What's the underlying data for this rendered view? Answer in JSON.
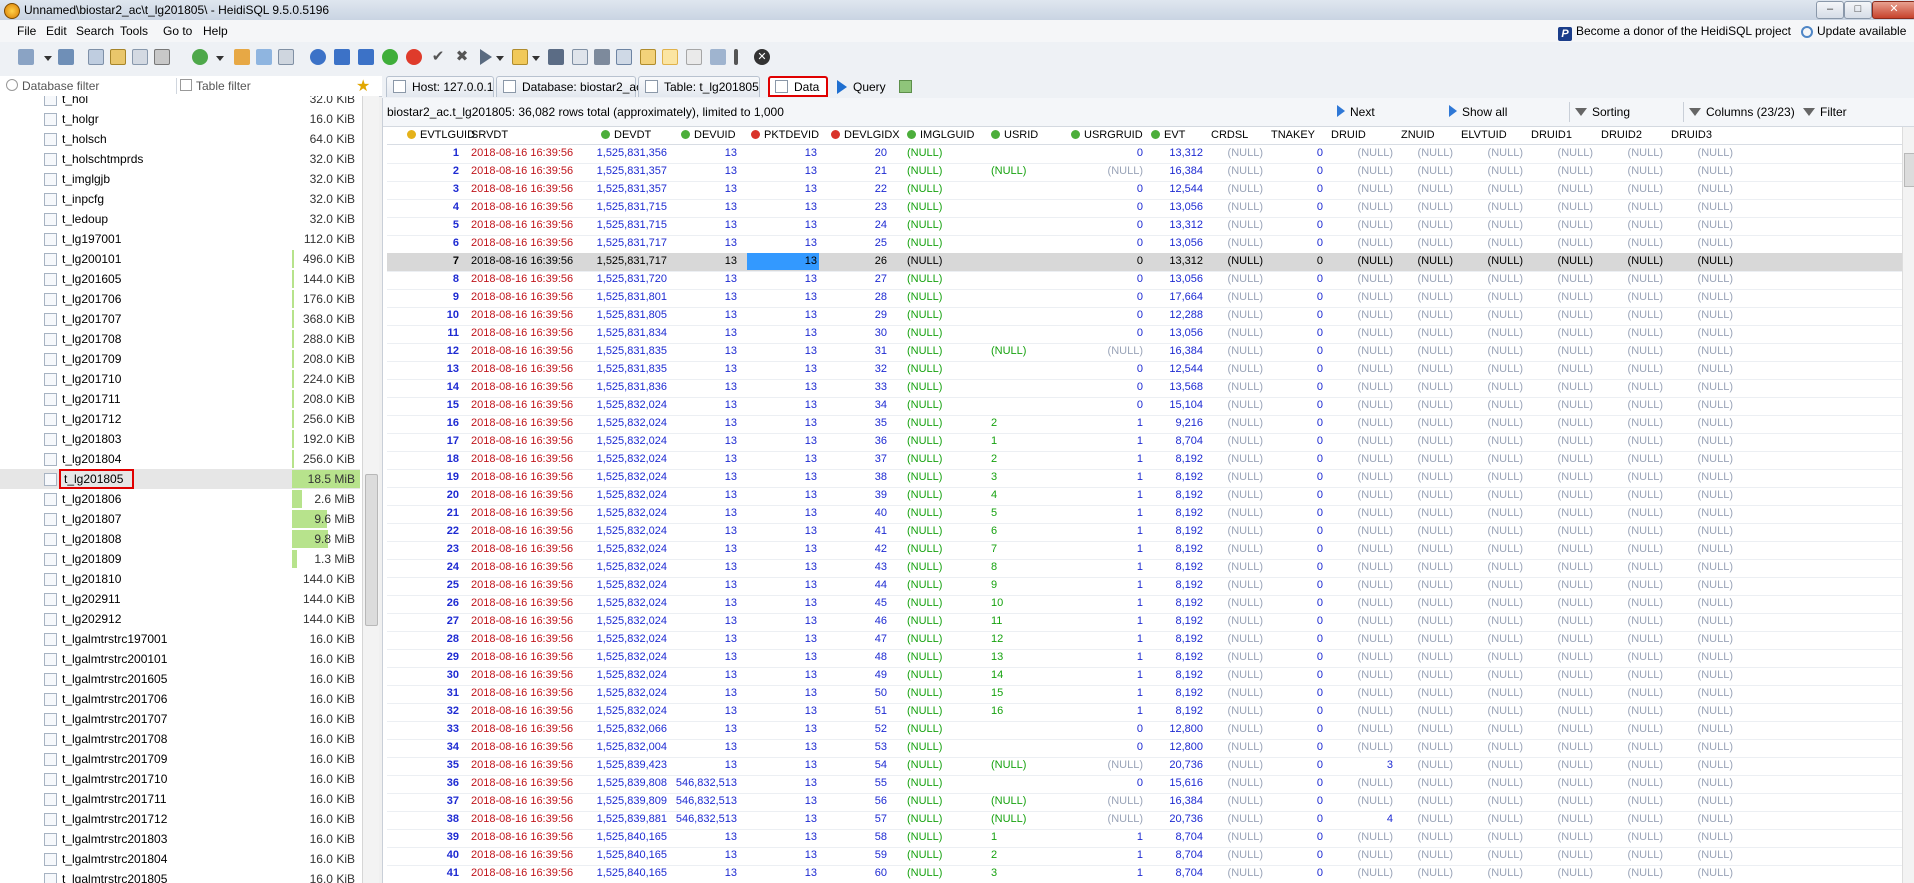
{
  "window": {
    "title": "Unnamed\\biostar2_ac\\t_lg201805\\ - HeidiSQL 9.5.0.5196",
    "controls": [
      "–",
      "□",
      "✕"
    ]
  },
  "menu": {
    "items": [
      "File",
      "Edit",
      "Search",
      "Tools",
      "Go to",
      "Help"
    ],
    "donor": "Become a donor of the HeidiSQL project",
    "update": "Update available"
  },
  "filters": {
    "database_placeholder": "Database filter",
    "table_placeholder": "Table filter"
  },
  "tree": {
    "items": [
      {
        "name": "t_hol",
        "size": "32.0 KiB",
        "bar": 0
      },
      {
        "name": "t_holgr",
        "size": "16.0 KiB",
        "bar": 0
      },
      {
        "name": "t_holsch",
        "size": "64.0 KiB",
        "bar": 0
      },
      {
        "name": "t_holschtmprds",
        "size": "32.0 KiB",
        "bar": 0
      },
      {
        "name": "t_imglgjb",
        "size": "32.0 KiB",
        "bar": 0
      },
      {
        "name": "t_inpcfg",
        "size": "32.0 KiB",
        "bar": 0
      },
      {
        "name": "t_ledoup",
        "size": "32.0 KiB",
        "bar": 0
      },
      {
        "name": "t_lg197001",
        "size": "112.0 KiB",
        "bar": 0
      },
      {
        "name": "t_lg200101",
        "size": "496.0 KiB",
        "bar": 0.03
      },
      {
        "name": "t_lg201605",
        "size": "144.0 KiB",
        "bar": 0.01
      },
      {
        "name": "t_lg201706",
        "size": "176.0 KiB",
        "bar": 0.01
      },
      {
        "name": "t_lg201707",
        "size": "368.0 KiB",
        "bar": 0.02
      },
      {
        "name": "t_lg201708",
        "size": "288.0 KiB",
        "bar": 0.02
      },
      {
        "name": "t_lg201709",
        "size": "208.0 KiB",
        "bar": 0.01
      },
      {
        "name": "t_lg201710",
        "size": "224.0 KiB",
        "bar": 0.01
      },
      {
        "name": "t_lg201711",
        "size": "208.0 KiB",
        "bar": 0.01
      },
      {
        "name": "t_lg201712",
        "size": "256.0 KiB",
        "bar": 0.01
      },
      {
        "name": "t_lg201803",
        "size": "192.0 KiB",
        "bar": 0.01
      },
      {
        "name": "t_lg201804",
        "size": "256.0 KiB",
        "bar": 0.01
      },
      {
        "name": "t_lg201805",
        "size": "18.5 MiB",
        "bar": 1.0,
        "selected": true
      },
      {
        "name": "t_lg201806",
        "size": "2.6 MiB",
        "bar": 0.14
      },
      {
        "name": "t_lg201807",
        "size": "9.6 MiB",
        "bar": 0.52
      },
      {
        "name": "t_lg201808",
        "size": "9.8 MiB",
        "bar": 0.53
      },
      {
        "name": "t_lg201809",
        "size": "1.3 MiB",
        "bar": 0.07
      },
      {
        "name": "t_lg201810",
        "size": "144.0 KiB",
        "bar": 0
      },
      {
        "name": "t_lg202911",
        "size": "144.0 KiB",
        "bar": 0
      },
      {
        "name": "t_lg202912",
        "size": "144.0 KiB",
        "bar": 0
      },
      {
        "name": "t_lgalmtrstrc197001",
        "size": "16.0 KiB",
        "bar": 0
      },
      {
        "name": "t_lgalmtrstrc200101",
        "size": "16.0 KiB",
        "bar": 0
      },
      {
        "name": "t_lgalmtrstrc201605",
        "size": "16.0 KiB",
        "bar": 0
      },
      {
        "name": "t_lgalmtrstrc201706",
        "size": "16.0 KiB",
        "bar": 0
      },
      {
        "name": "t_lgalmtrstrc201707",
        "size": "16.0 KiB",
        "bar": 0
      },
      {
        "name": "t_lgalmtrstrc201708",
        "size": "16.0 KiB",
        "bar": 0
      },
      {
        "name": "t_lgalmtrstrc201709",
        "size": "16.0 KiB",
        "bar": 0
      },
      {
        "name": "t_lgalmtrstrc201710",
        "size": "16.0 KiB",
        "bar": 0
      },
      {
        "name": "t_lgalmtrstrc201711",
        "size": "16.0 KiB",
        "bar": 0
      },
      {
        "name": "t_lgalmtrstrc201712",
        "size": "16.0 KiB",
        "bar": 0
      },
      {
        "name": "t_lgalmtrstrc201803",
        "size": "16.0 KiB",
        "bar": 0
      },
      {
        "name": "t_lgalmtrstrc201804",
        "size": "16.0 KiB",
        "bar": 0
      },
      {
        "name": "t_lgalmtrstrc201805",
        "size": "16.0 KiB",
        "bar": 0
      }
    ]
  },
  "tabs": [
    {
      "label": "Host: 127.0.0.1"
    },
    {
      "label": "Database: biostar2_ac"
    },
    {
      "label": "Table: t_lg201805"
    },
    {
      "label": "Data",
      "active": true
    },
    {
      "label": "Query"
    }
  ],
  "info": {
    "text": "biostar2_ac.t_lg201805: 36,082 rows total (approximately), limited to 1,000",
    "next": "Next",
    "show_all": "Show all",
    "sorting": "Sorting",
    "columns": "Columns (23/23)",
    "filter": "Filter"
  },
  "columns": [
    "EVTLGUID",
    "SRVDT",
    "DEVDT",
    "DEVUID",
    "PKTDEVID",
    "DEVLGIDX",
    "IMGLGUID",
    "USRID",
    "USRGRUID",
    "EVT",
    "CRDSL",
    "TNAKEY",
    "DRUID",
    "ZNUID",
    "ELVTUID",
    "DRUID1",
    "DRUID2",
    "DRUID3"
  ],
  "rows": [
    [
      "1",
      "2018-08-16 16:39:56",
      "1,525,831,356",
      "13",
      "13",
      "20",
      "(NULL)",
      "",
      "0",
      "13,312",
      "(NULL)",
      "0",
      "(NULL)",
      "(NULL)",
      "(NULL)",
      "(NULL)",
      "(NULL)",
      "(NULL)"
    ],
    [
      "2",
      "2018-08-16 16:39:56",
      "1,525,831,357",
      "13",
      "13",
      "21",
      "(NULL)",
      "(NULL)",
      "(NULL)",
      "16,384",
      "(NULL)",
      "0",
      "(NULL)",
      "(NULL)",
      "(NULL)",
      "(NULL)",
      "(NULL)",
      "(NULL)"
    ],
    [
      "3",
      "2018-08-16 16:39:56",
      "1,525,831,357",
      "13",
      "13",
      "22",
      "(NULL)",
      "",
      "0",
      "12,544",
      "(NULL)",
      "0",
      "(NULL)",
      "(NULL)",
      "(NULL)",
      "(NULL)",
      "(NULL)",
      "(NULL)"
    ],
    [
      "4",
      "2018-08-16 16:39:56",
      "1,525,831,715",
      "13",
      "13",
      "23",
      "(NULL)",
      "",
      "0",
      "13,056",
      "(NULL)",
      "0",
      "(NULL)",
      "(NULL)",
      "(NULL)",
      "(NULL)",
      "(NULL)",
      "(NULL)"
    ],
    [
      "5",
      "2018-08-16 16:39:56",
      "1,525,831,715",
      "13",
      "13",
      "24",
      "(NULL)",
      "",
      "0",
      "13,312",
      "(NULL)",
      "0",
      "(NULL)",
      "(NULL)",
      "(NULL)",
      "(NULL)",
      "(NULL)",
      "(NULL)"
    ],
    [
      "6",
      "2018-08-16 16:39:56",
      "1,525,831,717",
      "13",
      "13",
      "25",
      "(NULL)",
      "",
      "0",
      "13,056",
      "(NULL)",
      "0",
      "(NULL)",
      "(NULL)",
      "(NULL)",
      "(NULL)",
      "(NULL)",
      "(NULL)"
    ],
    [
      "7",
      "2018-08-16 16:39:56",
      "1,525,831,717",
      "13",
      "13",
      "26",
      "(NULL)",
      "",
      "0",
      "13,312",
      "(NULL)",
      "0",
      "(NULL)",
      "(NULL)",
      "(NULL)",
      "(NULL)",
      "(NULL)",
      "(NULL)"
    ],
    [
      "8",
      "2018-08-16 16:39:56",
      "1,525,831,720",
      "13",
      "13",
      "27",
      "(NULL)",
      "",
      "0",
      "13,056",
      "(NULL)",
      "0",
      "(NULL)",
      "(NULL)",
      "(NULL)",
      "(NULL)",
      "(NULL)",
      "(NULL)"
    ],
    [
      "9",
      "2018-08-16 16:39:56",
      "1,525,831,801",
      "13",
      "13",
      "28",
      "(NULL)",
      "",
      "0",
      "17,664",
      "(NULL)",
      "0",
      "(NULL)",
      "(NULL)",
      "(NULL)",
      "(NULL)",
      "(NULL)",
      "(NULL)"
    ],
    [
      "10",
      "2018-08-16 16:39:56",
      "1,525,831,805",
      "13",
      "13",
      "29",
      "(NULL)",
      "",
      "0",
      "12,288",
      "(NULL)",
      "0",
      "(NULL)",
      "(NULL)",
      "(NULL)",
      "(NULL)",
      "(NULL)",
      "(NULL)"
    ],
    [
      "11",
      "2018-08-16 16:39:56",
      "1,525,831,834",
      "13",
      "13",
      "30",
      "(NULL)",
      "",
      "0",
      "13,056",
      "(NULL)",
      "0",
      "(NULL)",
      "(NULL)",
      "(NULL)",
      "(NULL)",
      "(NULL)",
      "(NULL)"
    ],
    [
      "12",
      "2018-08-16 16:39:56",
      "1,525,831,835",
      "13",
      "13",
      "31",
      "(NULL)",
      "(NULL)",
      "(NULL)",
      "16,384",
      "(NULL)",
      "0",
      "(NULL)",
      "(NULL)",
      "(NULL)",
      "(NULL)",
      "(NULL)",
      "(NULL)"
    ],
    [
      "13",
      "2018-08-16 16:39:56",
      "1,525,831,835",
      "13",
      "13",
      "32",
      "(NULL)",
      "",
      "0",
      "12,544",
      "(NULL)",
      "0",
      "(NULL)",
      "(NULL)",
      "(NULL)",
      "(NULL)",
      "(NULL)",
      "(NULL)"
    ],
    [
      "14",
      "2018-08-16 16:39:56",
      "1,525,831,836",
      "13",
      "13",
      "33",
      "(NULL)",
      "",
      "0",
      "13,568",
      "(NULL)",
      "0",
      "(NULL)",
      "(NULL)",
      "(NULL)",
      "(NULL)",
      "(NULL)",
      "(NULL)"
    ],
    [
      "15",
      "2018-08-16 16:39:56",
      "1,525,832,024",
      "13",
      "13",
      "34",
      "(NULL)",
      "",
      "0",
      "15,104",
      "(NULL)",
      "0",
      "(NULL)",
      "(NULL)",
      "(NULL)",
      "(NULL)",
      "(NULL)",
      "(NULL)"
    ],
    [
      "16",
      "2018-08-16 16:39:56",
      "1,525,832,024",
      "13",
      "13",
      "35",
      "(NULL)",
      "2",
      "1",
      "9,216",
      "(NULL)",
      "0",
      "(NULL)",
      "(NULL)",
      "(NULL)",
      "(NULL)",
      "(NULL)",
      "(NULL)"
    ],
    [
      "17",
      "2018-08-16 16:39:56",
      "1,525,832,024",
      "13",
      "13",
      "36",
      "(NULL)",
      "1",
      "1",
      "8,704",
      "(NULL)",
      "0",
      "(NULL)",
      "(NULL)",
      "(NULL)",
      "(NULL)",
      "(NULL)",
      "(NULL)"
    ],
    [
      "18",
      "2018-08-16 16:39:56",
      "1,525,832,024",
      "13",
      "13",
      "37",
      "(NULL)",
      "2",
      "1",
      "8,192",
      "(NULL)",
      "0",
      "(NULL)",
      "(NULL)",
      "(NULL)",
      "(NULL)",
      "(NULL)",
      "(NULL)"
    ],
    [
      "19",
      "2018-08-16 16:39:56",
      "1,525,832,024",
      "13",
      "13",
      "38",
      "(NULL)",
      "3",
      "1",
      "8,192",
      "(NULL)",
      "0",
      "(NULL)",
      "(NULL)",
      "(NULL)",
      "(NULL)",
      "(NULL)",
      "(NULL)"
    ],
    [
      "20",
      "2018-08-16 16:39:56",
      "1,525,832,024",
      "13",
      "13",
      "39",
      "(NULL)",
      "4",
      "1",
      "8,192",
      "(NULL)",
      "0",
      "(NULL)",
      "(NULL)",
      "(NULL)",
      "(NULL)",
      "(NULL)",
      "(NULL)"
    ],
    [
      "21",
      "2018-08-16 16:39:56",
      "1,525,832,024",
      "13",
      "13",
      "40",
      "(NULL)",
      "5",
      "1",
      "8,192",
      "(NULL)",
      "0",
      "(NULL)",
      "(NULL)",
      "(NULL)",
      "(NULL)",
      "(NULL)",
      "(NULL)"
    ],
    [
      "22",
      "2018-08-16 16:39:56",
      "1,525,832,024",
      "13",
      "13",
      "41",
      "(NULL)",
      "6",
      "1",
      "8,192",
      "(NULL)",
      "0",
      "(NULL)",
      "(NULL)",
      "(NULL)",
      "(NULL)",
      "(NULL)",
      "(NULL)"
    ],
    [
      "23",
      "2018-08-16 16:39:56",
      "1,525,832,024",
      "13",
      "13",
      "42",
      "(NULL)",
      "7",
      "1",
      "8,192",
      "(NULL)",
      "0",
      "(NULL)",
      "(NULL)",
      "(NULL)",
      "(NULL)",
      "(NULL)",
      "(NULL)"
    ],
    [
      "24",
      "2018-08-16 16:39:56",
      "1,525,832,024",
      "13",
      "13",
      "43",
      "(NULL)",
      "8",
      "1",
      "8,192",
      "(NULL)",
      "0",
      "(NULL)",
      "(NULL)",
      "(NULL)",
      "(NULL)",
      "(NULL)",
      "(NULL)"
    ],
    [
      "25",
      "2018-08-16 16:39:56",
      "1,525,832,024",
      "13",
      "13",
      "44",
      "(NULL)",
      "9",
      "1",
      "8,192",
      "(NULL)",
      "0",
      "(NULL)",
      "(NULL)",
      "(NULL)",
      "(NULL)",
      "(NULL)",
      "(NULL)"
    ],
    [
      "26",
      "2018-08-16 16:39:56",
      "1,525,832,024",
      "13",
      "13",
      "45",
      "(NULL)",
      "10",
      "1",
      "8,192",
      "(NULL)",
      "0",
      "(NULL)",
      "(NULL)",
      "(NULL)",
      "(NULL)",
      "(NULL)",
      "(NULL)"
    ],
    [
      "27",
      "2018-08-16 16:39:56",
      "1,525,832,024",
      "13",
      "13",
      "46",
      "(NULL)",
      "11",
      "1",
      "8,192",
      "(NULL)",
      "0",
      "(NULL)",
      "(NULL)",
      "(NULL)",
      "(NULL)",
      "(NULL)",
      "(NULL)"
    ],
    [
      "28",
      "2018-08-16 16:39:56",
      "1,525,832,024",
      "13",
      "13",
      "47",
      "(NULL)",
      "12",
      "1",
      "8,192",
      "(NULL)",
      "0",
      "(NULL)",
      "(NULL)",
      "(NULL)",
      "(NULL)",
      "(NULL)",
      "(NULL)"
    ],
    [
      "29",
      "2018-08-16 16:39:56",
      "1,525,832,024",
      "13",
      "13",
      "48",
      "(NULL)",
      "13",
      "1",
      "8,192",
      "(NULL)",
      "0",
      "(NULL)",
      "(NULL)",
      "(NULL)",
      "(NULL)",
      "(NULL)",
      "(NULL)"
    ],
    [
      "30",
      "2018-08-16 16:39:56",
      "1,525,832,024",
      "13",
      "13",
      "49",
      "(NULL)",
      "14",
      "1",
      "8,192",
      "(NULL)",
      "0",
      "(NULL)",
      "(NULL)",
      "(NULL)",
      "(NULL)",
      "(NULL)",
      "(NULL)"
    ],
    [
      "31",
      "2018-08-16 16:39:56",
      "1,525,832,024",
      "13",
      "13",
      "50",
      "(NULL)",
      "15",
      "1",
      "8,192",
      "(NULL)",
      "0",
      "(NULL)",
      "(NULL)",
      "(NULL)",
      "(NULL)",
      "(NULL)",
      "(NULL)"
    ],
    [
      "32",
      "2018-08-16 16:39:56",
      "1,525,832,024",
      "13",
      "13",
      "51",
      "(NULL)",
      "16",
      "1",
      "8,192",
      "(NULL)",
      "0",
      "(NULL)",
      "(NULL)",
      "(NULL)",
      "(NULL)",
      "(NULL)",
      "(NULL)"
    ],
    [
      "33",
      "2018-08-16 16:39:56",
      "1,525,832,066",
      "13",
      "13",
      "52",
      "(NULL)",
      "",
      "0",
      "12,800",
      "(NULL)",
      "0",
      "(NULL)",
      "(NULL)",
      "(NULL)",
      "(NULL)",
      "(NULL)",
      "(NULL)"
    ],
    [
      "34",
      "2018-08-16 16:39:56",
      "1,525,832,004",
      "13",
      "13",
      "53",
      "(NULL)",
      "",
      "0",
      "12,800",
      "(NULL)",
      "0",
      "(NULL)",
      "(NULL)",
      "(NULL)",
      "(NULL)",
      "(NULL)",
      "(NULL)"
    ],
    [
      "35",
      "2018-08-16 16:39:56",
      "1,525,839,423",
      "13",
      "13",
      "54",
      "(NULL)",
      "(NULL)",
      "(NULL)",
      "20,736",
      "(NULL)",
      "0",
      "3",
      "(NULL)",
      "(NULL)",
      "(NULL)",
      "(NULL)",
      "(NULL)"
    ],
    [
      "36",
      "2018-08-16 16:39:56",
      "1,525,839,808",
      "546,832,513",
      "13",
      "55",
      "(NULL)",
      "",
      "0",
      "15,616",
      "(NULL)",
      "0",
      "(NULL)",
      "(NULL)",
      "(NULL)",
      "(NULL)",
      "(NULL)",
      "(NULL)"
    ],
    [
      "37",
      "2018-08-16 16:39:56",
      "1,525,839,809",
      "546,832,513",
      "13",
      "56",
      "(NULL)",
      "(NULL)",
      "(NULL)",
      "16,384",
      "(NULL)",
      "0",
      "(NULL)",
      "(NULL)",
      "(NULL)",
      "(NULL)",
      "(NULL)",
      "(NULL)"
    ],
    [
      "38",
      "2018-08-16 16:39:56",
      "1,525,839,881",
      "546,832,513",
      "13",
      "57",
      "(NULL)",
      "(NULL)",
      "(NULL)",
      "20,736",
      "(NULL)",
      "0",
      "4",
      "(NULL)",
      "(NULL)",
      "(NULL)",
      "(NULL)",
      "(NULL)"
    ],
    [
      "39",
      "2018-08-16 16:39:56",
      "1,525,840,165",
      "13",
      "13",
      "58",
      "(NULL)",
      "1",
      "1",
      "8,704",
      "(NULL)",
      "0",
      "(NULL)",
      "(NULL)",
      "(NULL)",
      "(NULL)",
      "(NULL)",
      "(NULL)"
    ],
    [
      "40",
      "2018-08-16 16:39:56",
      "1,525,840,165",
      "13",
      "13",
      "59",
      "(NULL)",
      "2",
      "1",
      "8,704",
      "(NULL)",
      "0",
      "(NULL)",
      "(NULL)",
      "(NULL)",
      "(NULL)",
      "(NULL)",
      "(NULL)"
    ],
    [
      "41",
      "2018-08-16 16:39:56",
      "1,525,840,165",
      "13",
      "13",
      "60",
      "(NULL)",
      "3",
      "1",
      "8,704",
      "(NULL)",
      "0",
      "(NULL)",
      "(NULL)",
      "(NULL)",
      "(NULL)",
      "(NULL)",
      "(NULL)"
    ]
  ],
  "selected_row": 7
}
